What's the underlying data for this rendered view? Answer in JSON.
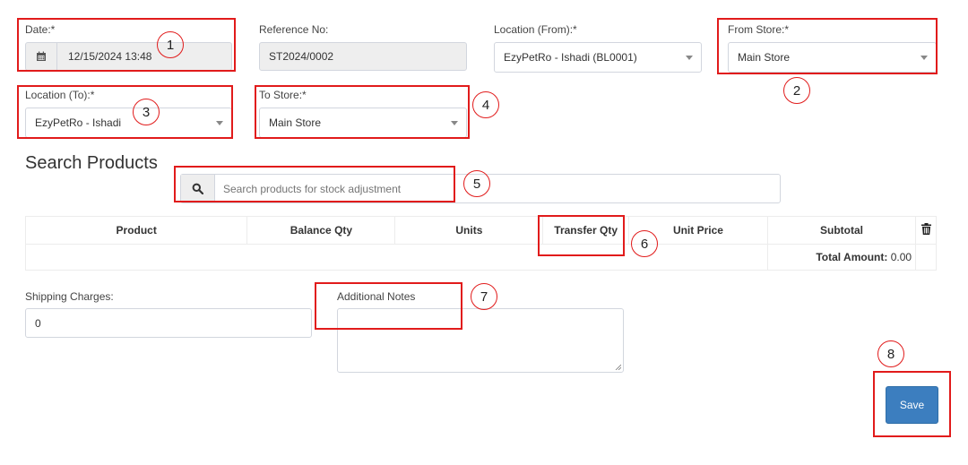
{
  "form": {
    "date": {
      "label": "Date:*",
      "value": "12/15/2024 13:48"
    },
    "reference": {
      "label": "Reference No:",
      "value": "ST2024/0002"
    },
    "location_from": {
      "label": "Location (From):*",
      "value": "EzyPetRo - Ishadi (BL0001)"
    },
    "from_store": {
      "label": "From Store:*",
      "value": "Main Store"
    },
    "location_to": {
      "label": "Location (To):*",
      "value": "EzyPetRo - Ishadi"
    },
    "to_store": {
      "label": "To Store:*",
      "value": "Main Store"
    }
  },
  "search": {
    "heading": "Search Products",
    "placeholder": "Search products for stock adjustment"
  },
  "table": {
    "columns": [
      "Product",
      "Balance Qty",
      "Units",
      "Transfer Qty",
      "Unit Price",
      "Subtotal"
    ],
    "total_label": "Total Amount:",
    "total_value": "0.00"
  },
  "shipping": {
    "label": "Shipping Charges:",
    "value": "0"
  },
  "notes": {
    "label": "Additional Notes",
    "value": ""
  },
  "actions": {
    "save_label": "Save"
  },
  "annotations": [
    "1",
    "2",
    "3",
    "4",
    "5",
    "6",
    "7",
    "8"
  ],
  "icons": {
    "calendar": "calendar-icon",
    "search": "search-icon",
    "delete": "trash-icon"
  },
  "colors": {
    "annotation": "#e11b1b",
    "primary_button": "#3c7ebf"
  }
}
